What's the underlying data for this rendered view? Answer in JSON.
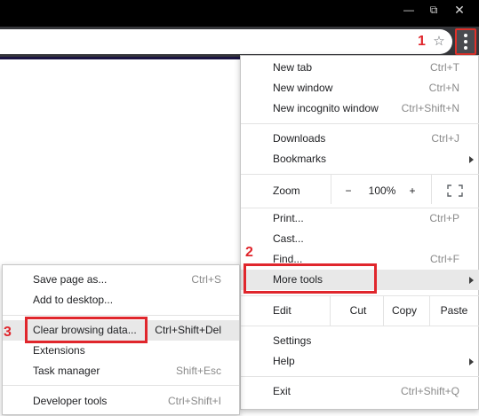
{
  "window_controls": {
    "minimize": "—",
    "restore": "⧉",
    "close": "✕"
  },
  "toolbar": {
    "star_icon": "☆",
    "menu_icon": "three-dots-vertical-icon"
  },
  "callouts": [
    "1",
    "2",
    "3"
  ],
  "main_menu": {
    "new_tab": {
      "label": "New tab",
      "shortcut": "Ctrl+T"
    },
    "new_window": {
      "label": "New window",
      "shortcut": "Ctrl+N"
    },
    "new_incognito": {
      "label": "New incognito window",
      "shortcut": "Ctrl+Shift+N"
    },
    "downloads": {
      "label": "Downloads",
      "shortcut": "Ctrl+J"
    },
    "bookmarks": {
      "label": "Bookmarks"
    },
    "zoom": {
      "label": "Zoom",
      "minus": "−",
      "value": "100%",
      "plus": "+"
    },
    "print": {
      "label": "Print...",
      "shortcut": "Ctrl+P"
    },
    "cast": {
      "label": "Cast..."
    },
    "find": {
      "label": "Find...",
      "shortcut": "Ctrl+F"
    },
    "more_tools": {
      "label": "More tools"
    },
    "edit": {
      "label": "Edit",
      "cut": "Cut",
      "copy": "Copy",
      "paste": "Paste"
    },
    "settings": {
      "label": "Settings"
    },
    "help": {
      "label": "Help"
    },
    "exit": {
      "label": "Exit",
      "shortcut": "Ctrl+Shift+Q"
    }
  },
  "more_tools_menu": {
    "save_page": {
      "label": "Save page as...",
      "shortcut": "Ctrl+S"
    },
    "add_desktop": {
      "label": "Add to desktop..."
    },
    "clear_data": {
      "label": "Clear browsing data...",
      "shortcut": "Ctrl+Shift+Del"
    },
    "extensions": {
      "label": "Extensions"
    },
    "task_manager": {
      "label": "Task manager",
      "shortcut": "Shift+Esc"
    },
    "developer_tools": {
      "label": "Developer tools",
      "shortcut": "Ctrl+Shift+I"
    }
  },
  "colors": {
    "titlebar": "#000000",
    "toolbar": "#35363a",
    "callout": "#e0262c",
    "hover": "#e8e8e8"
  }
}
